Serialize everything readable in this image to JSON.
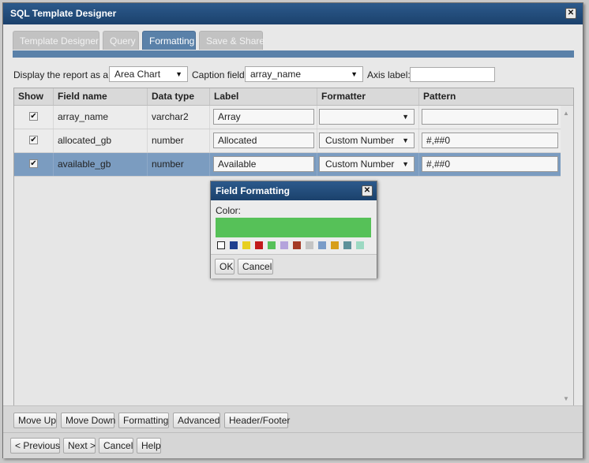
{
  "window": {
    "title": "SQL Template Designer",
    "close": "✕"
  },
  "tabs": [
    {
      "label": "Template Designer",
      "active": false
    },
    {
      "label": "Query",
      "active": false
    },
    {
      "label": "Formatting",
      "active": true
    },
    {
      "label": "Save & Share",
      "active": false
    }
  ],
  "options": {
    "display_label": "Display the report as a:",
    "display_value": "Area Chart",
    "caption_label": "Caption field:",
    "caption_value": "array_name",
    "axis_label": "Axis label:",
    "axis_value": ""
  },
  "grid": {
    "headers": [
      "Show",
      "Field name",
      "Data type",
      "Label",
      "Formatter",
      "Pattern"
    ],
    "rows": [
      {
        "show": "✔",
        "field": "array_name",
        "type": "varchar2",
        "label": "Array",
        "formatter": "",
        "pattern": ""
      },
      {
        "show": "✔",
        "field": "allocated_gb",
        "type": "number",
        "label": "Allocated",
        "formatter": "Custom Number",
        "pattern": "#,##0"
      },
      {
        "show": "✔",
        "field": "available_gb",
        "type": "number",
        "label": "Available",
        "formatter": "Custom Number",
        "pattern": "#,##0"
      }
    ]
  },
  "actions": {
    "move_up": "Move Up",
    "move_down": "Move Down",
    "formatting": "Formatting",
    "advanced": "Advanced",
    "header_footer": "Header/Footer"
  },
  "nav": {
    "previous": "< Previous",
    "next": "Next >",
    "cancel": "Cancel",
    "help": "Help"
  },
  "modal": {
    "title": "Field Formatting",
    "close": "✕",
    "color_label": "Color:",
    "selected_color": "#56c158",
    "swatches": [
      "#ffffff",
      "#1f3f8f",
      "#e7cf1f",
      "#c11b1b",
      "#56c158",
      "#b4a3dc",
      "#a43a26",
      "#c4c4c4",
      "#7a9cc8",
      "#d79e1a",
      "#5c919a",
      "#9cd9c2"
    ],
    "ok": "OK",
    "cancel": "Cancel"
  },
  "colors": {
    "titlebar": "#1f4a7a",
    "accent": "#5a81a9",
    "selected_row": "#7b9cc0"
  }
}
